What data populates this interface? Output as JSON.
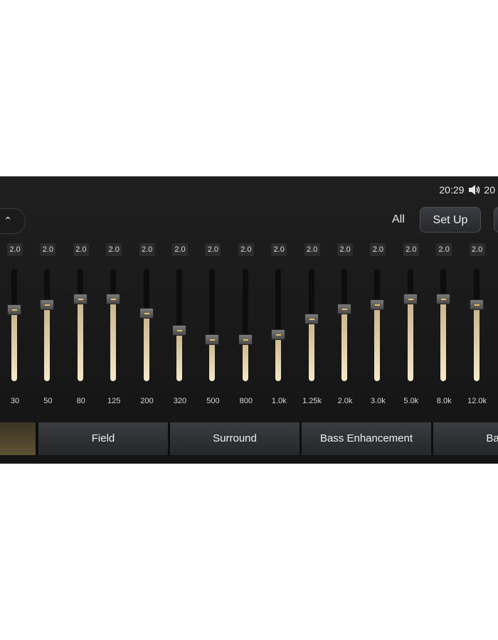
{
  "status": {
    "time": "20:29",
    "volume_level": "20"
  },
  "controls": {
    "all_label": "All",
    "setup_label": "Set Up"
  },
  "bands": [
    {
      "value": "2.0",
      "freq": "30",
      "level": 0.63
    },
    {
      "value": "2.0",
      "freq": "50",
      "level": 0.68
    },
    {
      "value": "2.0",
      "freq": "80",
      "level": 0.73
    },
    {
      "value": "2.0",
      "freq": "125",
      "level": 0.73
    },
    {
      "value": "2.0",
      "freq": "200",
      "level": 0.6
    },
    {
      "value": "2.0",
      "freq": "320",
      "level": 0.45
    },
    {
      "value": "2.0",
      "freq": "500",
      "level": 0.37
    },
    {
      "value": "2.0",
      "freq": "800",
      "level": 0.37
    },
    {
      "value": "2.0",
      "freq": "1.0k",
      "level": 0.41
    },
    {
      "value": "2.0",
      "freq": "1.25k",
      "level": 0.55
    },
    {
      "value": "2.0",
      "freq": "2.0k",
      "level": 0.64
    },
    {
      "value": "2.0",
      "freq": "3.0k",
      "level": 0.68
    },
    {
      "value": "2.0",
      "freq": "5.0k",
      "level": 0.73
    },
    {
      "value": "2.0",
      "freq": "8.0k",
      "level": 0.73
    },
    {
      "value": "2.0",
      "freq": "12.0k",
      "level": 0.68
    }
  ],
  "tabs": [
    {
      "label": ""
    },
    {
      "label": "Field"
    },
    {
      "label": "Surround"
    },
    {
      "label": "Bass Enhancement"
    },
    {
      "label": "Bass"
    }
  ],
  "colors": {
    "accent": "#e8c060",
    "fill_top": "#c8b48a",
    "fill_bottom": "#f6e9c8"
  }
}
